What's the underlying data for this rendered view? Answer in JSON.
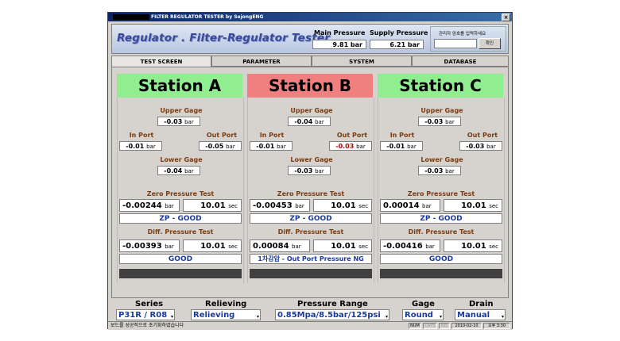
{
  "window": {
    "title": "FILTER REGULATOR TESTER by SejongENG",
    "close_glyph": "×"
  },
  "header": {
    "app_title": "Regulator . Filter-Regulator Tester",
    "main_pressure_label": "Main Pressure",
    "main_pressure_value": "9.81  bar",
    "supply_pressure_label": "Supply Pressure",
    "supply_pressure_value": "6.21  bar",
    "admin_label": "관리자 암호를 입력하세요",
    "admin_button": "확인"
  },
  "tabs": [
    "TEST SCREEN",
    "PARAMETER",
    "SYSTEM",
    "DATABASE"
  ],
  "labels": {
    "upper_gage": "Upper Gage",
    "in_port": "In Port",
    "out_port": "Out Port",
    "lower_gage": "Lower Gage",
    "zero_test": "Zero Pressure Test",
    "diff_test": "Diff. Pressure Test",
    "bar": "bar",
    "sec": "sec"
  },
  "stations": [
    {
      "name": "Station A",
      "header_color": "#90ee90",
      "upper": "-0.03",
      "in": "-0.01",
      "out": "-0.05",
      "lower": "-0.04",
      "zero_value": "-0.00244",
      "zero_time": "10.01",
      "zero_result": "ZP - GOOD",
      "diff_value": "-0.00393",
      "diff_time": "10.01",
      "diff_result": "GOOD"
    },
    {
      "name": "Station B",
      "header_color": "#f08080",
      "upper": "-0.04",
      "in": "-0.01",
      "out": "-0.03",
      "lower": "-0.03",
      "zero_value": "-0.00453",
      "zero_time": "10.01",
      "zero_result": "ZP - GOOD",
      "diff_value": "0.00084",
      "diff_time": "10.01",
      "diff_result": "1차감압 - Out Port Pressure NG"
    },
    {
      "name": "Station C",
      "header_color": "#90ee90",
      "upper": "-0.03",
      "in": "-0.01",
      "out": "-0.03",
      "lower": "-0.03",
      "zero_value": "0.00014",
      "zero_time": "10.01",
      "zero_result": "ZP - GOOD",
      "diff_value": "-0.00416",
      "diff_time": "10.01",
      "diff_result": "GOOD"
    }
  ],
  "bottom": {
    "series_label": "Series",
    "series_value": "P31R / R08",
    "relieving_label": "Relieving",
    "relieving_value": "Relieving",
    "range_label": "Pressure Range",
    "range_value": "0.85Mpa/8.5bar/125psi",
    "gage_label": "Gage",
    "gage_value": "Round",
    "drain_label": "Drain",
    "drain_value": "Manual"
  },
  "status": {
    "message": "보드를 성공적으로 초기화하였습니다",
    "num": "NUM",
    "caps": "CAPS",
    "ins": "INS",
    "date": "2010-02-10",
    "time": "오후 3:30"
  }
}
